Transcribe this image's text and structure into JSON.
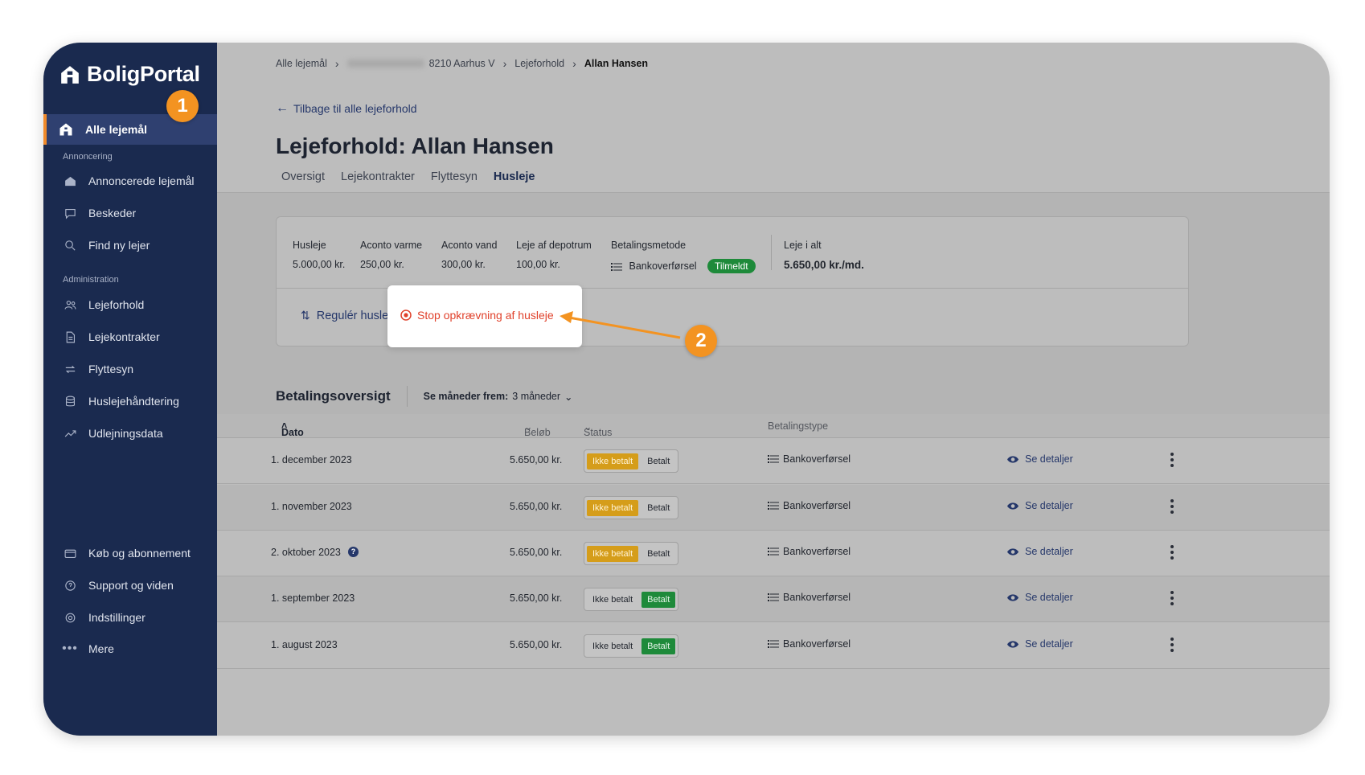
{
  "sidebar": {
    "brand": "BoligPortal",
    "active_item": "Alle lejemål",
    "section_annoncering": "Annoncering",
    "annoncering_items": [
      {
        "label": "Annoncerede lejemål",
        "icon": "home-icon"
      },
      {
        "label": "Beskeder",
        "icon": "chat-icon"
      },
      {
        "label": "Find ny lejer",
        "icon": "search-icon"
      }
    ],
    "section_administration": "Administration",
    "administration_items": [
      {
        "label": "Lejeforhold",
        "icon": "people-icon"
      },
      {
        "label": "Lejekontrakter",
        "icon": "document-icon"
      },
      {
        "label": "Flyttesyn",
        "icon": "swap-icon"
      },
      {
        "label": "Huslejehåndtering",
        "icon": "database-icon"
      },
      {
        "label": "Udlejningsdata",
        "icon": "trend-icon"
      }
    ],
    "bottom_items": [
      {
        "label": "Køb og abonnement",
        "icon": "card-icon"
      },
      {
        "label": "Support og viden",
        "icon": "help-icon"
      },
      {
        "label": "Indstillinger",
        "icon": "gear-icon"
      },
      {
        "label": "Mere",
        "icon": "more-icon"
      }
    ]
  },
  "breadcrumb": {
    "items": [
      "Alle lejemål",
      "8210 Aarhus V",
      "Lejeforhold"
    ],
    "current": "Allan Hansen"
  },
  "back_link": "Tilbage til alle lejeforhold",
  "title": {
    "prefix": "Lejeforhold:",
    "name": "Allan Hansen"
  },
  "tabs": [
    "Oversigt",
    "Lejekontrakter",
    "Flyttesyn",
    "Husleje"
  ],
  "active_tab": "Husleje",
  "rent": {
    "fields": [
      {
        "label": "Husleje",
        "value": "5.000,00 kr."
      },
      {
        "label": "Aconto varme",
        "value": "250,00 kr."
      },
      {
        "label": "Aconto vand",
        "value": "300,00 kr."
      },
      {
        "label": "Leje af depotrum",
        "value": "100,00 kr."
      }
    ],
    "payment_method_label": "Betalingsmetode",
    "payment_method_value": "Bankoverførsel",
    "payment_status_badge": "Tilmeldt",
    "total_label": "Leje i alt",
    "total_value": "5.650,00 kr./md.",
    "regulate_button": "Regulér husleje",
    "stop_button": "Stop opkrævning af husleje"
  },
  "annotations": {
    "badge_1": "1",
    "badge_2": "2",
    "color": "#f39321"
  },
  "payments": {
    "title": "Betalingsoversigt",
    "filter_label": "Se måneder frem:",
    "filter_value": "3 måneder",
    "columns": {
      "date": "Dato",
      "amount": "Beløb",
      "status": "Status",
      "type": "Betalingstype"
    },
    "status_options": {
      "unpaid": "Ikke betalt",
      "paid": "Betalt"
    },
    "details_label": "Se detaljer",
    "rows": [
      {
        "date": "1. december 2023",
        "amount": "5.650,00 kr.",
        "status": "unpaid",
        "type": "Bankoverførsel"
      },
      {
        "date": "1. november 2023",
        "amount": "5.650,00 kr.",
        "status": "unpaid",
        "type": "Bankoverførsel"
      },
      {
        "date": "2. oktober 2023",
        "amount": "5.650,00 kr.",
        "status": "unpaid",
        "type": "Bankoverførsel",
        "help": true
      },
      {
        "date": "1. september 2023",
        "amount": "5.650,00 kr.",
        "status": "paid",
        "type": "Bankoverførsel"
      },
      {
        "date": "1. august 2023",
        "amount": "5.650,00 kr.",
        "status": "paid",
        "type": "Bankoverførsel"
      }
    ]
  },
  "colors": {
    "sidebar": "#1a2a4f",
    "accent": "#f08a2a",
    "danger": "#e0402a",
    "paid": "#1e8a3a",
    "unpaid": "#d59d1a"
  }
}
